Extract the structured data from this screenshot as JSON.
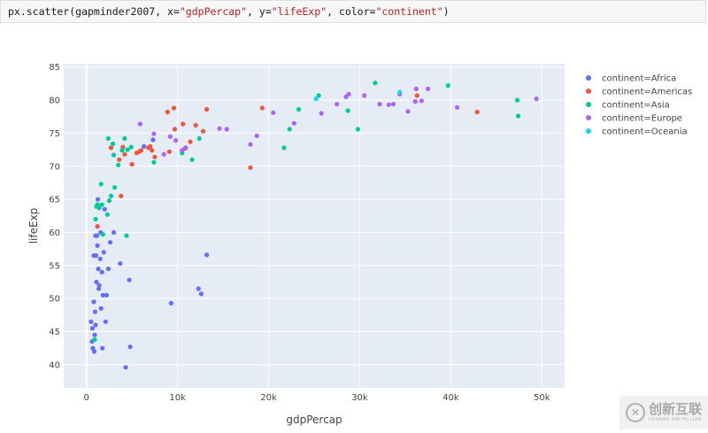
{
  "code": {
    "func": "px.scatter(gapminder2007, x=",
    "x_str": "\"gdpPercap\"",
    "sep1": ", y=",
    "y_str": "\"lifeExp\"",
    "sep2": ", color=",
    "c_str": "\"continent\"",
    "end": ")"
  },
  "watermark": {
    "text": "创新互联",
    "subtext": "CHUANG XIN HU LIAN",
    "glyph": "✕"
  },
  "chart_data": {
    "type": "scatter",
    "xlabel": "gdpPercap",
    "ylabel": "lifeExp",
    "xlim": [
      -2500,
      52500
    ],
    "ylim": [
      36.5,
      85.5
    ],
    "xticks": [
      0,
      10000,
      20000,
      30000,
      40000,
      50000
    ],
    "xtick_labels": [
      "0",
      "10k",
      "20k",
      "30k",
      "40k",
      "50k"
    ],
    "yticks": [
      40,
      45,
      50,
      55,
      60,
      65,
      70,
      75,
      80,
      85
    ],
    "grid": true,
    "legend_position": "top-right",
    "series": [
      {
        "name": "continent=Africa",
        "color": "#636efa",
        "points": [
          [
            500,
            46.5
          ],
          [
            600,
            43.5
          ],
          [
            650,
            45.5
          ],
          [
            700,
            42.5
          ],
          [
            800,
            49.5
          ],
          [
            850,
            42
          ],
          [
            900,
            44.5
          ],
          [
            950,
            48
          ],
          [
            1000,
            46
          ],
          [
            1050,
            56.5
          ],
          [
            1100,
            52.5
          ],
          [
            1150,
            59.5
          ],
          [
            1200,
            58
          ],
          [
            1250,
            65
          ],
          [
            1300,
            54.5
          ],
          [
            1350,
            51.5
          ],
          [
            1400,
            52
          ],
          [
            1500,
            56
          ],
          [
            1550,
            60
          ],
          [
            1600,
            48.5
          ],
          [
            1700,
            54
          ],
          [
            1750,
            42.5
          ],
          [
            1800,
            50.5
          ],
          [
            1900,
            57
          ],
          [
            2000,
            63.5
          ],
          [
            2100,
            46.5
          ],
          [
            2200,
            50.5
          ],
          [
            2400,
            54.5
          ],
          [
            2600,
            58.5
          ],
          [
            3000,
            60
          ],
          [
            3700,
            55.3
          ],
          [
            4300,
            39.6
          ],
          [
            4700,
            52.8
          ],
          [
            4800,
            42.7
          ],
          [
            9300,
            49.3
          ],
          [
            12300,
            51.5
          ],
          [
            12600,
            50.7
          ],
          [
            13200,
            56.6
          ],
          [
            6300,
            73
          ],
          [
            7300,
            74
          ],
          [
            1000,
            59.5
          ],
          [
            800,
            56.5
          ]
        ]
      },
      {
        "name": "continent=Americas",
        "color": "#ef553b",
        "points": [
          [
            1200,
            60.9
          ],
          [
            2700,
            72.8
          ],
          [
            3600,
            71
          ],
          [
            3800,
            65.5
          ],
          [
            4000,
            72.9
          ],
          [
            4200,
            71.8
          ],
          [
            5000,
            70.3
          ],
          [
            5500,
            72
          ],
          [
            5800,
            72.2
          ],
          [
            6000,
            72.4
          ],
          [
            6800,
            72.8
          ],
          [
            7000,
            73
          ],
          [
            7200,
            72.4
          ],
          [
            7500,
            71.4
          ],
          [
            8900,
            78.2
          ],
          [
            9100,
            72.2
          ],
          [
            9600,
            78.8
          ],
          [
            9700,
            75.6
          ],
          [
            10600,
            76.4
          ],
          [
            10800,
            72.7
          ],
          [
            11400,
            73.7
          ],
          [
            12000,
            76.2
          ],
          [
            12800,
            75.3
          ],
          [
            13200,
            78.6
          ],
          [
            18000,
            69.8
          ],
          [
            19300,
            78.8
          ],
          [
            36300,
            80.7
          ],
          [
            42900,
            78.2
          ]
        ]
      },
      {
        "name": "continent=Asia",
        "color": "#00cc96",
        "points": [
          [
            900,
            43.8
          ],
          [
            1000,
            62
          ],
          [
            1100,
            63.9
          ],
          [
            1200,
            64.2
          ],
          [
            1400,
            63.7
          ],
          [
            1600,
            67.3
          ],
          [
            1700,
            64.2
          ],
          [
            1800,
            59.7
          ],
          [
            2300,
            62.7
          ],
          [
            2400,
            74.2
          ],
          [
            2500,
            64.8
          ],
          [
            2700,
            65.5
          ],
          [
            2900,
            73.4
          ],
          [
            3000,
            71.7
          ],
          [
            3100,
            66.8
          ],
          [
            3500,
            70.2
          ],
          [
            3900,
            72.4
          ],
          [
            4200,
            74.2
          ],
          [
            4400,
            59.5
          ],
          [
            4500,
            72.5
          ],
          [
            4900,
            72.9
          ],
          [
            7400,
            70.6
          ],
          [
            10500,
            72
          ],
          [
            11600,
            71
          ],
          [
            12400,
            74.2
          ],
          [
            21700,
            72.8
          ],
          [
            22300,
            75.6
          ],
          [
            23300,
            78.6
          ],
          [
            25500,
            80.7
          ],
          [
            28700,
            78.4
          ],
          [
            29800,
            75.6
          ],
          [
            31700,
            82.6
          ],
          [
            39700,
            82.2
          ],
          [
            47300,
            80
          ],
          [
            47400,
            77.6
          ]
        ]
      },
      {
        "name": "continent=Europe",
        "color": "#ab63fa",
        "points": [
          [
            5900,
            76.4
          ],
          [
            7400,
            74.9
          ],
          [
            8500,
            71.8
          ],
          [
            9200,
            74.5
          ],
          [
            9800,
            73.9
          ],
          [
            10500,
            72.4
          ],
          [
            10900,
            72.8
          ],
          [
            14600,
            75.7
          ],
          [
            15400,
            75.6
          ],
          [
            18000,
            73.3
          ],
          [
            18700,
            74.6
          ],
          [
            20500,
            78.1
          ],
          [
            22800,
            76.5
          ],
          [
            25800,
            78
          ],
          [
            27500,
            79.4
          ],
          [
            28500,
            80.5
          ],
          [
            28800,
            80.9
          ],
          [
            30500,
            80.7
          ],
          [
            32200,
            79.4
          ],
          [
            33200,
            79.3
          ],
          [
            33700,
            79.4
          ],
          [
            34400,
            80.9
          ],
          [
            35300,
            78.3
          ],
          [
            36100,
            79.8
          ],
          [
            36200,
            81.7
          ],
          [
            36800,
            79.9
          ],
          [
            37500,
            81.7
          ],
          [
            40700,
            78.9
          ],
          [
            49400,
            80.2
          ]
        ]
      },
      {
        "name": "continent=Oceania",
        "color": "#19d3f3",
        "points": [
          [
            25200,
            80.2
          ],
          [
            34400,
            81.2
          ]
        ]
      }
    ]
  }
}
